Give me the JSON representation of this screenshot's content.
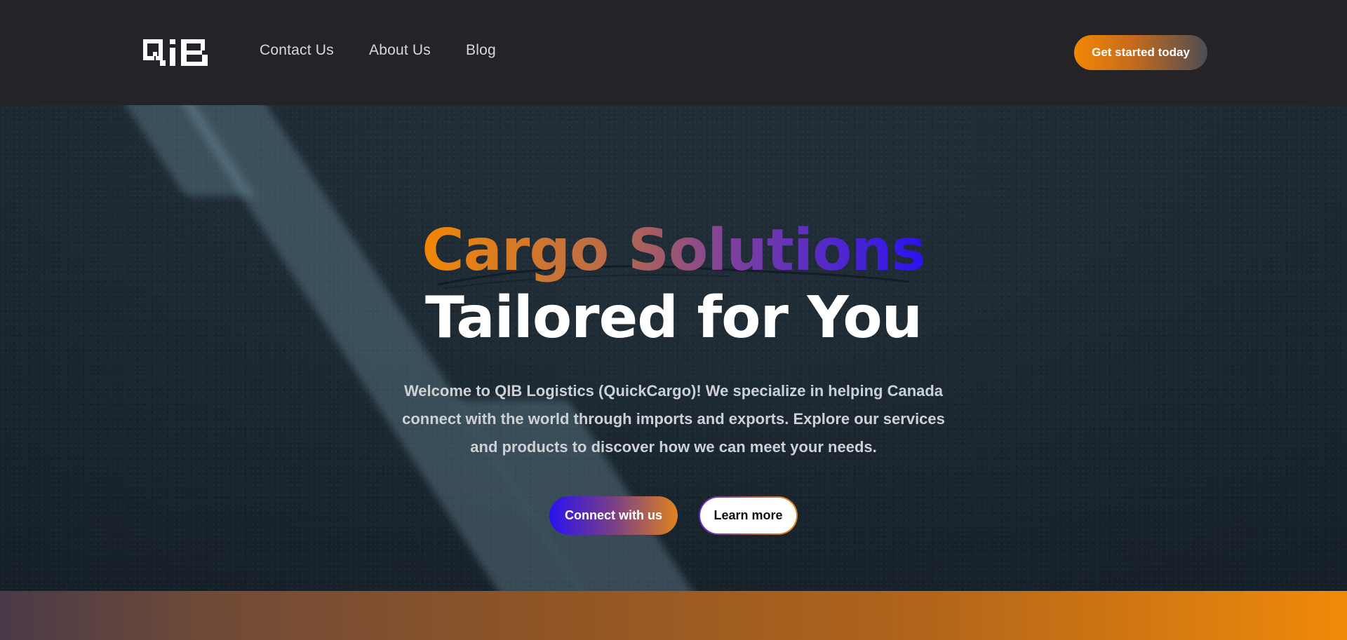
{
  "navbar": {
    "logo_text": "QiB",
    "links": [
      {
        "label": "Contact Us"
      },
      {
        "label": "About Us"
      },
      {
        "label": "Blog"
      }
    ],
    "cta_label": "Get started today"
  },
  "hero": {
    "title_line1": "Cargo Solutions",
    "title_line2": "Tailored for You",
    "description": "Welcome to QIB Logistics (QuickCargo)! We specialize in helping Canada connect with the world through imports and exports. Explore our services and products to discover how we can meet your needs.",
    "primary_button": "Connect with us",
    "secondary_button": "Learn more"
  },
  "colors": {
    "brand_orange": "#f28705",
    "brand_blue": "#2a12f0",
    "nav_background": "#242328"
  }
}
